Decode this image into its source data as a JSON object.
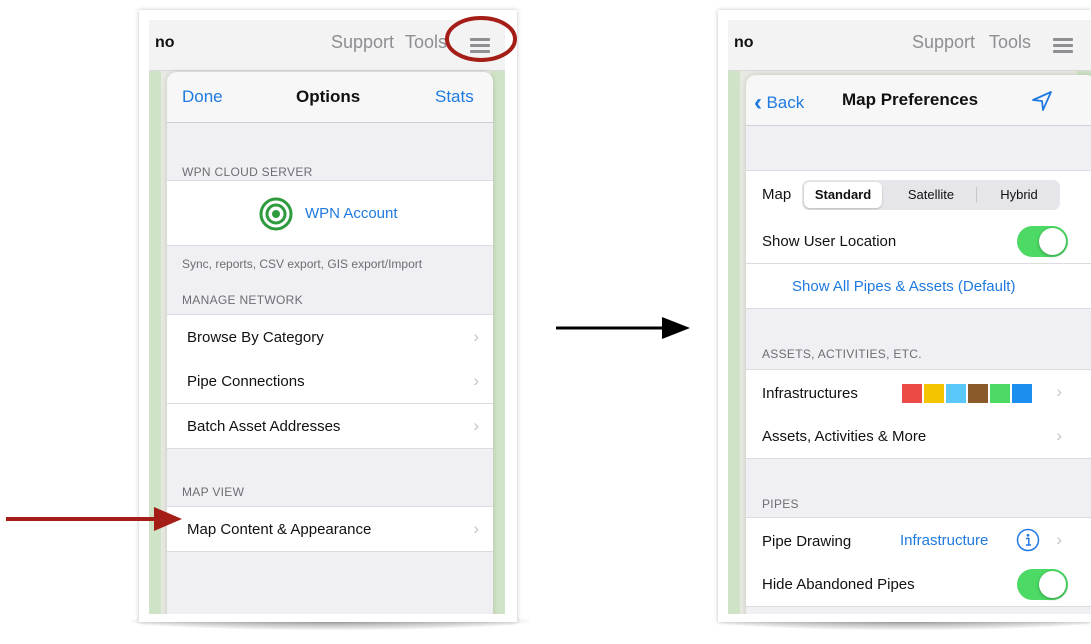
{
  "left": {
    "topbar": {
      "brand": "no",
      "support": "Support",
      "tools": "Tools"
    },
    "nav": {
      "left": "Done",
      "title": "Options",
      "right": "Stats"
    },
    "sections": {
      "cloud": "WPN CLOUD SERVER",
      "account_label": "WPN Account",
      "cloud_footer": "Sync, reports, CSV export, GIS export/Import",
      "manage": "MANAGE NETWORK",
      "map_view": "MAP VIEW"
    },
    "manage_items": [
      "Browse By Category",
      "Pipe Connections",
      "Batch Asset Addresses"
    ],
    "map_items": [
      "Map Content & Appearance"
    ]
  },
  "right": {
    "topbar": {
      "brand": "no",
      "support": "Support",
      "tools": "Tools"
    },
    "nav": {
      "back": "Back",
      "title": "Map Preferences"
    },
    "map_row": {
      "label": "Map",
      "options": [
        "Standard",
        "Satellite",
        "Hybrid"
      ],
      "selected": "Standard"
    },
    "show_user_location": "Show User Location",
    "show_all_link": "Show All Pipes & Assets (Default)",
    "assets_header": "ASSETS, ACTIVITIES, ETC.",
    "infrastructures": "Infrastructures",
    "infra_colors": [
      "#ec4a44",
      "#f5c400",
      "#5ac8fa",
      "#8b5a2b",
      "#4cd964",
      "#1c8ef0"
    ],
    "assets_more": "Assets, Activities & More",
    "pipes_header": "PIPES",
    "pipe_drawing": "Pipe Drawing",
    "pipe_drawing_value": "Infrastructure",
    "hide_abandoned": "Hide Abandoned Pipes"
  },
  "colors": {
    "accent": "#1f7ae0",
    "annotation_red": "#a51d17",
    "toggle_on": "#4cd964"
  }
}
